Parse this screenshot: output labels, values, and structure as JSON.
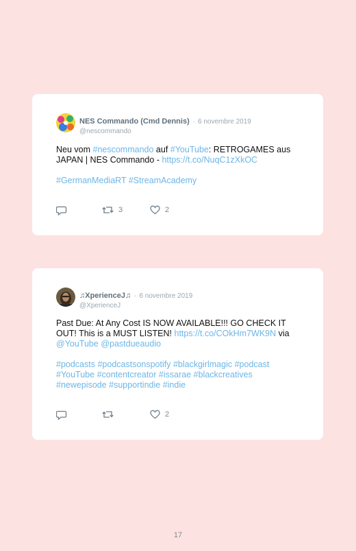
{
  "tweets": [
    {
      "name": "NES Commando (Cmd Dennis)",
      "separator": "·",
      "date": "6 novembre 2019",
      "handle": "@nescommando",
      "p1": [
        {
          "t": "Neu vom ",
          "link": false
        },
        {
          "t": "#nescommando",
          "link": true
        },
        {
          "t": " auf ",
          "link": false
        },
        {
          "t": "#YouTube",
          "link": true
        },
        {
          "t": ": RETROGAMES aus JAPAN | NES Commando - ",
          "link": false
        },
        {
          "t": "https://t.co/NuqC1zXkOC",
          "link": true
        }
      ],
      "p2": [
        "#GermanMediaRT",
        "#StreamAcademy"
      ],
      "reply_icon": "reply-icon",
      "retweet_icon": "retweet-icon",
      "like_icon": "heart-icon",
      "retweets": "3",
      "likes": "2"
    },
    {
      "name": "♫XperienceJ♫",
      "separator": "·",
      "date": "6 novembre 2019",
      "handle": "@XperienceJ",
      "p1": [
        {
          "t": "Past Due: At Any Cost IS NOW AVAILABLE!!! GO CHECK IT OUT! This is a MUST LISTEN! ",
          "link": false
        },
        {
          "t": "https://t.co/COkHm7WK9N",
          "link": true
        },
        {
          "t": " via ",
          "link": false
        },
        {
          "t": "@YouTube",
          "link": true
        },
        {
          "t": " ",
          "link": false
        },
        {
          "t": "@pastdueaudio",
          "link": true
        }
      ],
      "p2": [
        "#podcasts",
        "#podcastsonspotify",
        "#blackgirlmagic",
        "#podcast",
        "#YouTube",
        "#contentcreator",
        "#issarae",
        "#blackcreatives",
        "#newepisode",
        "#supportindie",
        "#indie"
      ],
      "reply_icon": "reply-icon",
      "retweet_icon": "retweet-icon",
      "like_icon": "heart-icon",
      "retweets": "",
      "likes": "2"
    }
  ],
  "page_number": "17",
  "colors": {
    "background": "#fde2e2",
    "card": "#ffffff",
    "link": "#6cb6e6",
    "muted": "#9aa7b1",
    "name": "#5f6f7c"
  }
}
